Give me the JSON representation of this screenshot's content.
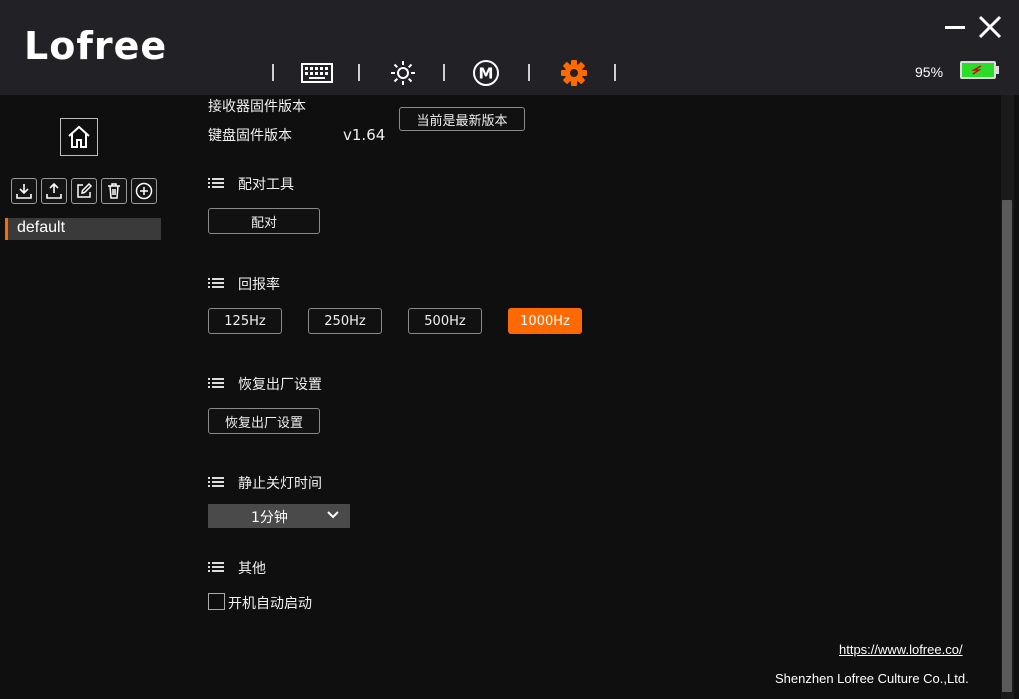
{
  "app": {
    "logo": "Lofree"
  },
  "nav": {
    "icons": [
      "keyboard-icon",
      "brightness-icon",
      "macro-icon",
      "settings-icon"
    ],
    "macro_letter": "M"
  },
  "battery": {
    "percent": "95%",
    "level": 0.95,
    "color": "#2bdc2b"
  },
  "sidebar": {
    "tools": [
      "import-icon",
      "export-icon",
      "edit-icon",
      "delete-icon",
      "add-icon"
    ],
    "profiles": [
      {
        "label": "default",
        "selected": true
      }
    ]
  },
  "firmware": {
    "receiver_label": "接收器固件版本",
    "keyboard_label": "键盘固件版本",
    "keyboard_version": "v1.64",
    "update_button": "当前是最新版本"
  },
  "pairing": {
    "title": "配对工具",
    "button": "配对"
  },
  "report_rate": {
    "title": "回报率",
    "options": [
      "125Hz",
      "250Hz",
      "500Hz",
      "1000Hz"
    ],
    "selected": "1000Hz"
  },
  "factory_reset": {
    "title": "恢复出厂设置",
    "button": "恢复出厂设置"
  },
  "light_off": {
    "title": "静止关灯时间",
    "value": "1分钟"
  },
  "other": {
    "title": "其他",
    "autostart_label": "开机自动启动",
    "autostart_checked": false
  },
  "footer": {
    "link": "https://www.lofree.co/",
    "company": "Shenzhen Lofree Culture Co.,Ltd."
  },
  "colors": {
    "accent": "#ff6a00",
    "header_bg": "#222226",
    "body_bg": "#0f0f10"
  }
}
